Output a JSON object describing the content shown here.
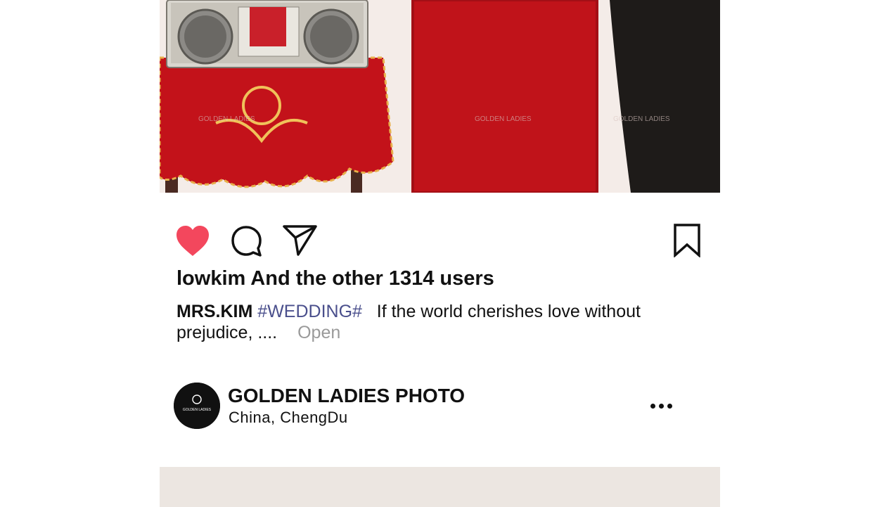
{
  "post": {
    "image_watermark": "GOLDEN LADIES",
    "actions": {
      "like_icon": "heart-filled-icon",
      "comment_icon": "speech-bubble-icon",
      "share_icon": "paper-plane-icon",
      "bookmark_icon": "bookmark-icon",
      "like_color": "#f3475d"
    },
    "likes_text": "lowkim And the other 1314 users",
    "caption": {
      "author": "MRS.KIM",
      "hashtag": "#WEDDING#",
      "text": "If the world cherishes love without prejudice, ....",
      "open_label": "Open"
    }
  },
  "next_post": {
    "account_name": "GOLDEN LADIES PHOTO",
    "location": "China, ChengDu",
    "avatar_text": "GOLDEN LADIES",
    "more_icon": "more-dots-icon"
  }
}
